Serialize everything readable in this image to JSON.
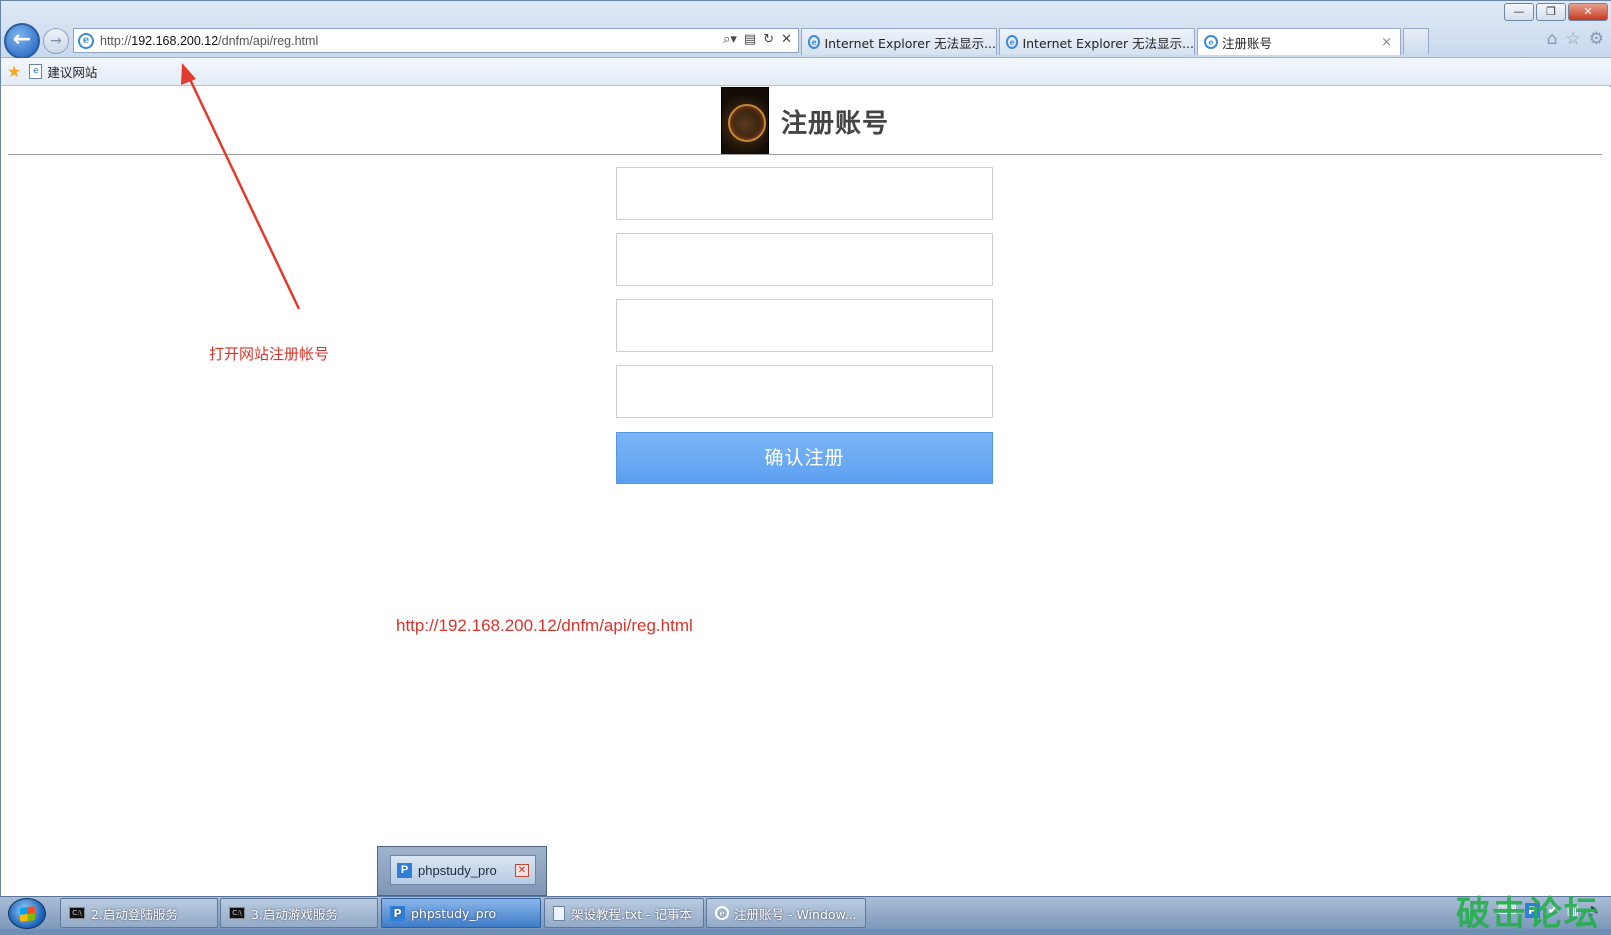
{
  "browser": {
    "address_url_prefix": "http://",
    "address_url_host": "192.168.200.12",
    "address_url_path": "/dnfm/api/reg.html",
    "tabs": [
      {
        "label": "Internet Explorer 无法显示..."
      },
      {
        "label": "Internet Explorer 无法显示..."
      },
      {
        "label": "注册账号"
      }
    ],
    "tab_close": "×",
    "favorites": {
      "suggested_sites": "建议网站"
    },
    "window_controls": {
      "minimize": "—",
      "restore": "❐",
      "close": "✕"
    }
  },
  "page": {
    "title": "注册账号",
    "fields": [
      {
        "value": "",
        "placeholder": ""
      },
      {
        "value": "",
        "placeholder": ""
      },
      {
        "value": "",
        "placeholder": ""
      },
      {
        "value": "",
        "placeholder": ""
      }
    ],
    "submit_label": "确认注册"
  },
  "annotations": {
    "note_text": "打开网站注册帐号",
    "note_url": "http://192.168.200.12/dnfm/api/reg.html",
    "color": "#d9342b"
  },
  "preview": {
    "label": "phpstudy_pro"
  },
  "taskbar": {
    "items": [
      {
        "label": "2.启动登陆服务"
      },
      {
        "label": "3.启动游戏服务"
      },
      {
        "label": "phpstudy_pro"
      },
      {
        "label": "架设教程.txt - 记事本"
      },
      {
        "label": "注册账号 - Window..."
      }
    ]
  },
  "watermark": "破击论坛",
  "icons": [
    "back-arrow-icon",
    "forward-arrow-icon",
    "ie-icon",
    "search-icon",
    "refresh-icon",
    "stop-icon",
    "home-icon",
    "favorites-star-icon",
    "gear-icon",
    "windows-start-icon",
    "cmd-icon",
    "notepad-icon",
    "phpstudy-icon"
  ]
}
